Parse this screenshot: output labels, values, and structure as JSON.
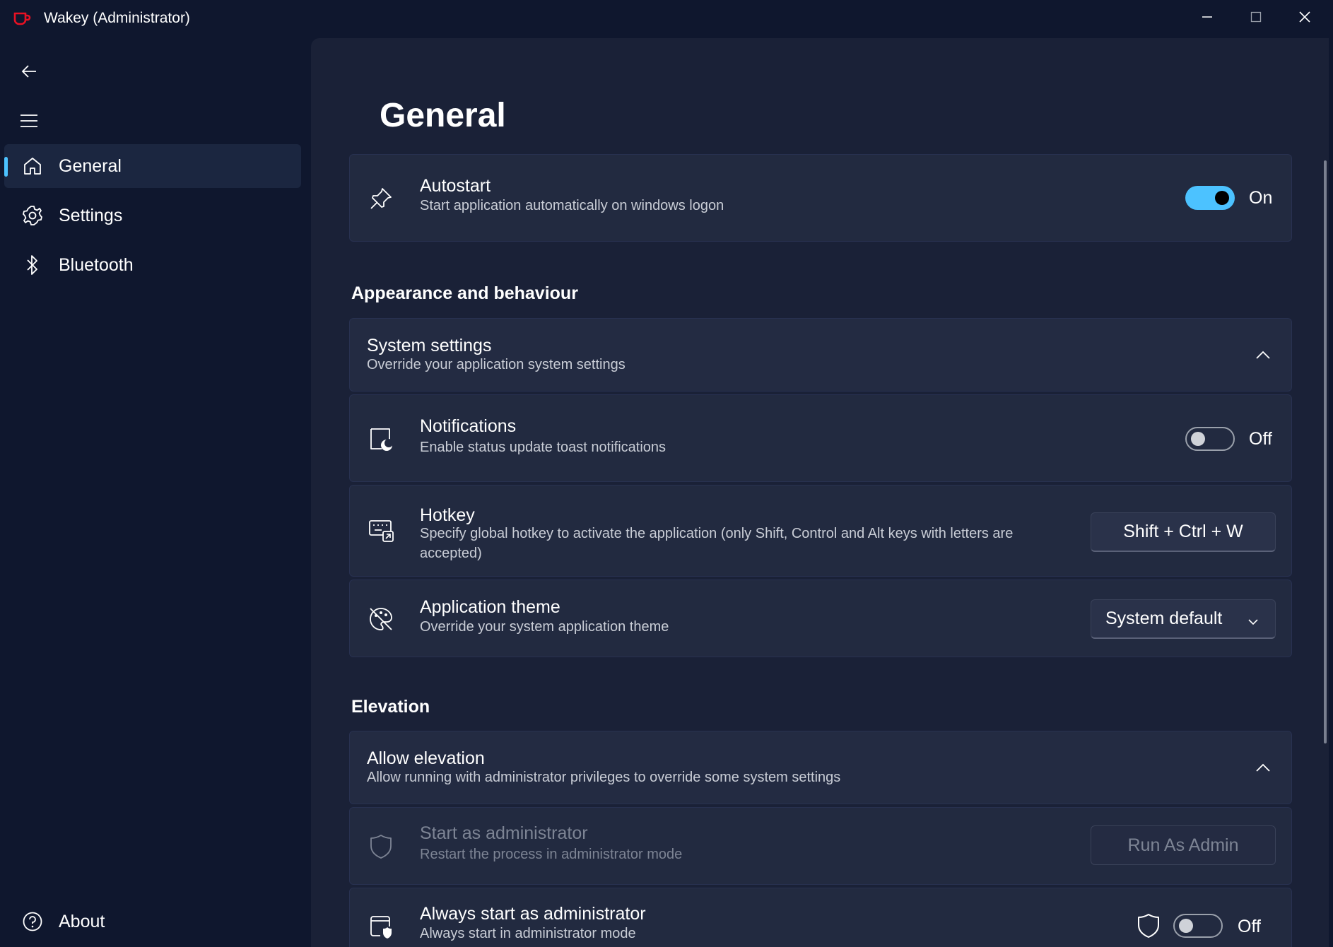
{
  "window": {
    "title": "Wakey (Administrator)"
  },
  "colors": {
    "accent": "#4cc2ff",
    "app_icon": "#e81123",
    "background": "#0f172e",
    "card": "#222a40"
  },
  "sidebar": {
    "items": [
      {
        "label": "General",
        "icon": "home-icon",
        "selected": true
      },
      {
        "label": "Settings",
        "icon": "gear-icon",
        "selected": false
      },
      {
        "label": "Bluetooth",
        "icon": "bluetooth-icon",
        "selected": false
      }
    ],
    "footer": {
      "label": "About",
      "icon": "help-icon"
    }
  },
  "page": {
    "title": "General"
  },
  "autostart": {
    "title": "Autostart",
    "description": "Start application automatically on windows logon",
    "state": "On"
  },
  "appearance": {
    "section_title": "Appearance and behaviour",
    "system_settings": {
      "title": "System settings",
      "description": "Override your application system settings"
    },
    "notifications": {
      "title": "Notifications",
      "description": "Enable status update toast notifications",
      "state": "Off"
    },
    "hotkey": {
      "title": "Hotkey",
      "description": "Specify global hotkey to activate the application (only Shift, Control and Alt keys with letters are accepted)",
      "value": "Shift + Ctrl + W"
    },
    "theme": {
      "title": "Application theme",
      "description": "Override your system application theme",
      "selected": "System default"
    }
  },
  "elevation": {
    "section_title": "Elevation",
    "allow": {
      "title": "Allow elevation",
      "description": "Allow running with administrator privileges to override some system settings"
    },
    "start_admin": {
      "title": "Start as administrator",
      "description": "Restart the process in administrator mode",
      "button": "Run As Admin"
    },
    "always_admin": {
      "title": "Always start as administrator",
      "description": "Always start in administrator mode",
      "state": "Off"
    }
  }
}
